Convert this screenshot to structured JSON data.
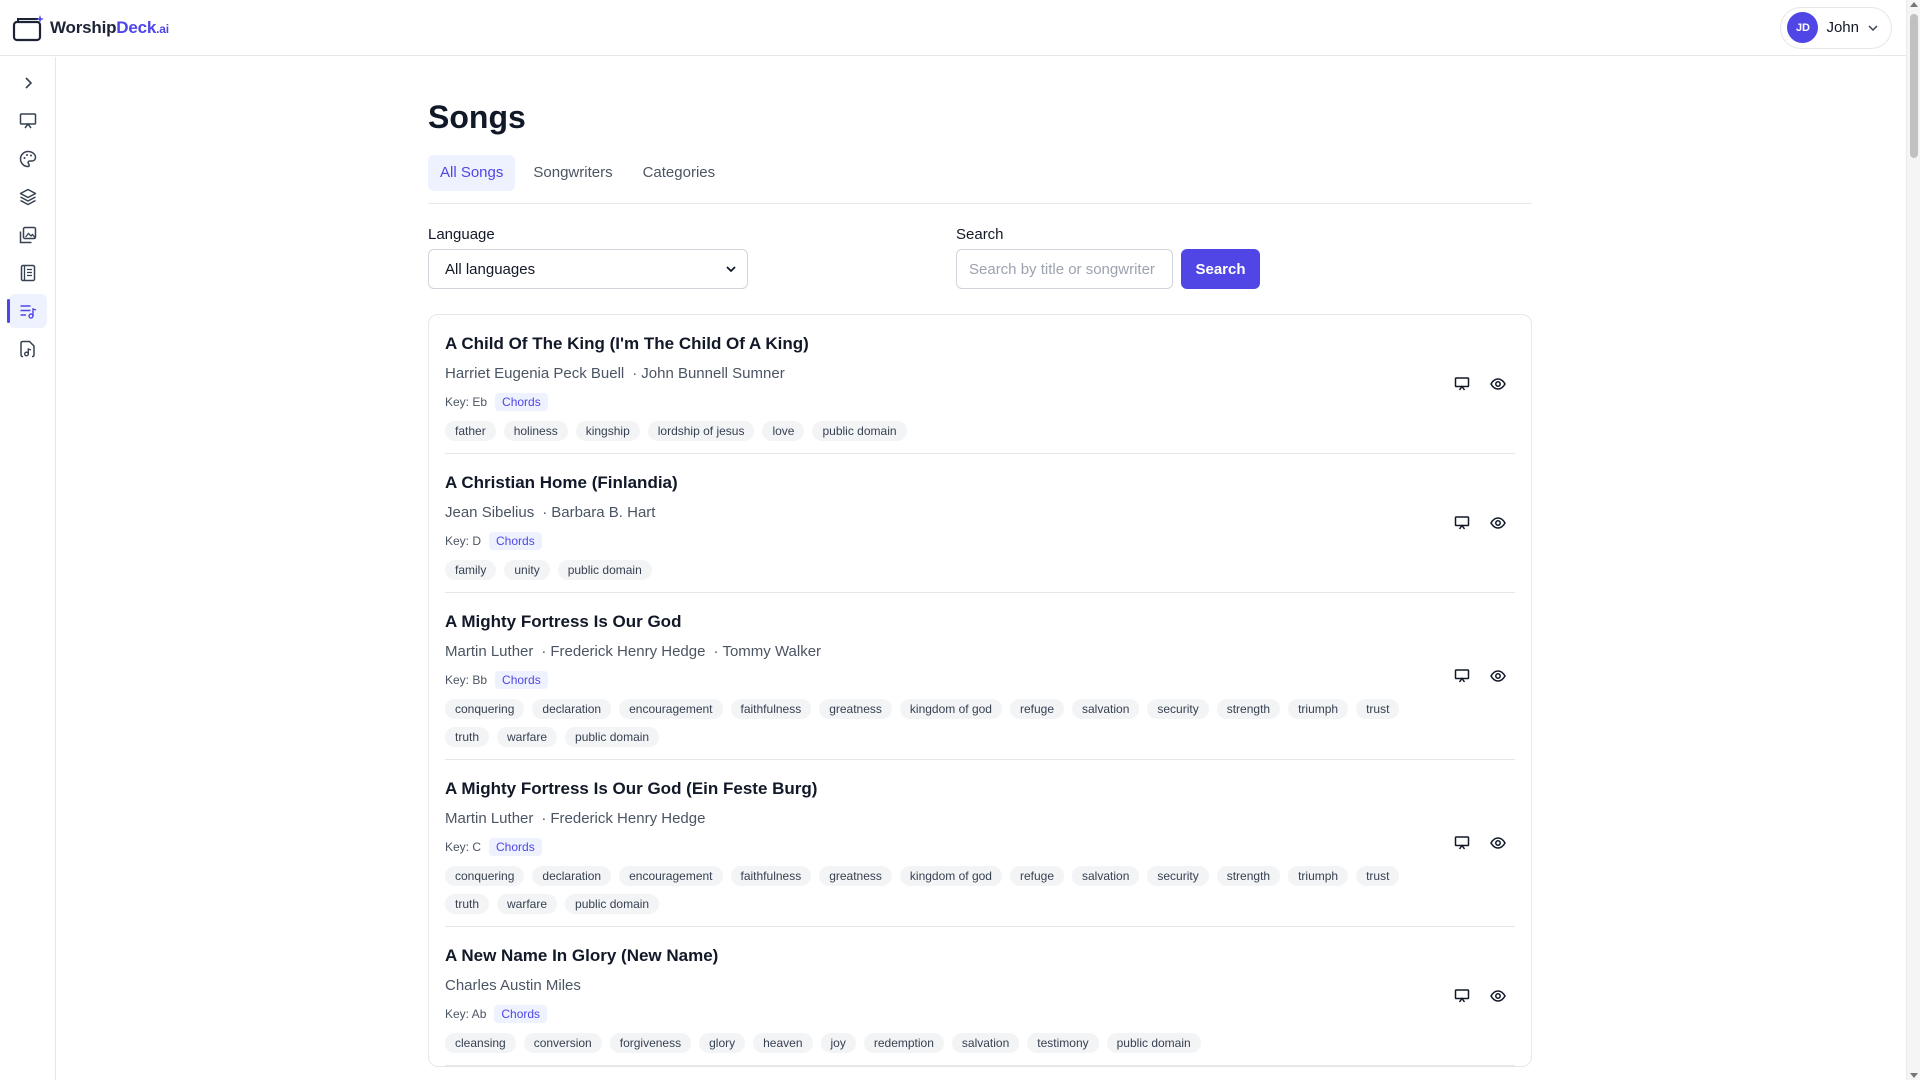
{
  "brand": {
    "name_part1": "Worship",
    "name_part2": "Deck",
    "name_suffix": ".ai",
    "accent": "#4f46e5"
  },
  "user": {
    "initials": "JD",
    "name": "John"
  },
  "sidebar": {
    "items": [
      {
        "name": "expand-sidebar",
        "icon": "chevron-right-icon",
        "active": false
      },
      {
        "name": "presentations",
        "icon": "presentation-icon",
        "active": false
      },
      {
        "name": "themes",
        "icon": "palette-icon",
        "active": false
      },
      {
        "name": "layers",
        "icon": "layers-icon",
        "active": false
      },
      {
        "name": "media",
        "icon": "images-icon",
        "active": false
      },
      {
        "name": "bible",
        "icon": "book-icon",
        "active": false
      },
      {
        "name": "songs",
        "icon": "music-list-icon",
        "active": true
      },
      {
        "name": "song-files",
        "icon": "file-music-icon",
        "active": false
      }
    ]
  },
  "page": {
    "title": "Songs"
  },
  "tabs": [
    {
      "label": "All Songs",
      "active": true
    },
    {
      "label": "Songwriters",
      "active": false
    },
    {
      "label": "Categories",
      "active": false
    }
  ],
  "filters": {
    "language_label": "Language",
    "language_value": "All languages",
    "search_label": "Search",
    "search_placeholder": "Search by title or songwriter",
    "search_button": "Search"
  },
  "songs": [
    {
      "title": "A Child Of The King (I'm The Child Of A King)",
      "authors": [
        "Harriet Eugenia Peck Buell",
        "John Bunnell Sumner"
      ],
      "key": "Key: Eb",
      "chords": "Chords",
      "tags": [
        "father",
        "holiness",
        "kingship",
        "lordship of jesus",
        "love",
        "public domain"
      ]
    },
    {
      "title": "A Christian Home (Finlandia)",
      "authors": [
        "Jean Sibelius",
        "Barbara B. Hart"
      ],
      "key": "Key: D",
      "chords": "Chords",
      "tags": [
        "family",
        "unity",
        "public domain"
      ]
    },
    {
      "title": "A Mighty Fortress Is Our God",
      "authors": [
        "Martin Luther",
        "Frederick Henry Hedge",
        "Tommy Walker"
      ],
      "key": "Key: Bb",
      "chords": "Chords",
      "tags": [
        "conquering",
        "declaration",
        "encouragement",
        "faithfulness",
        "greatness",
        "kingdom of god",
        "refuge",
        "salvation",
        "security",
        "strength",
        "triumph",
        "trust",
        "truth",
        "warfare",
        "public domain"
      ]
    },
    {
      "title": "A Mighty Fortress Is Our God (Ein Feste Burg)",
      "authors": [
        "Martin Luther",
        "Frederick Henry Hedge"
      ],
      "key": "Key: C",
      "chords": "Chords",
      "tags": [
        "conquering",
        "declaration",
        "encouragement",
        "faithfulness",
        "greatness",
        "kingdom of god",
        "refuge",
        "salvation",
        "security",
        "strength",
        "triumph",
        "trust",
        "truth",
        "warfare",
        "public domain"
      ]
    },
    {
      "title": "A New Name In Glory (New Name)",
      "authors": [
        "Charles Austin Miles"
      ],
      "key": "Key: Ab",
      "chords": "Chords",
      "tags": [
        "cleansing",
        "conversion",
        "forgiveness",
        "glory",
        "heaven",
        "joy",
        "redemption",
        "salvation",
        "testimony",
        "public domain"
      ]
    }
  ]
}
